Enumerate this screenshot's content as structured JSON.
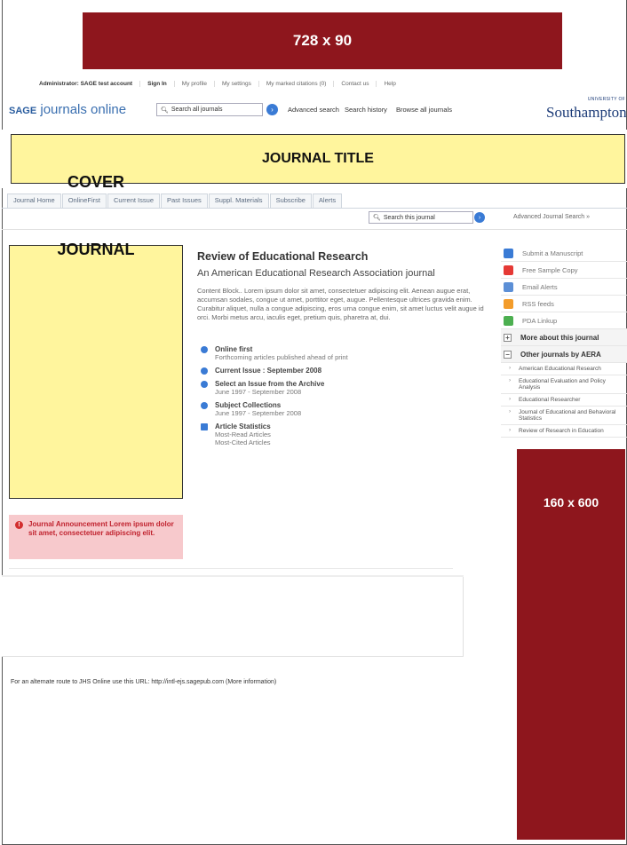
{
  "ads": {
    "top_label": "728 x 90",
    "side_label": "160 x 600",
    "color": "#8e161d"
  },
  "utility_links": [
    "Administrator: SAGE test account",
    "Sign In",
    "My profile",
    "My settings",
    "My marked citations (0)",
    "Contact us",
    "Help"
  ],
  "header": {
    "logo_sage": "SAGE",
    "logo_rest": "journals online",
    "search_placeholder": "Search all journals",
    "advanced_search": "Advanced search",
    "search_history": "Search history",
    "browse_all": "Browse all journals",
    "university_small": "UNIVERSITY OF",
    "university_name": "Southampton"
  },
  "journal_title_placeholder": "JOURNAL TITLE",
  "tabs": [
    "Journal Home",
    "OnlineFirst",
    "Current Issue",
    "Past Issues",
    "Suppl. Materials",
    "Subscribe",
    "Alerts"
  ],
  "journal_search": {
    "placeholder": "Search this journal",
    "advanced": "Advanced Journal Search »"
  },
  "cover": {
    "line1": "JOURNAL",
    "line2": "COVER"
  },
  "announcement": "Journal Announcement Lorem ipsum dolor sit amet, consectetuer adipiscing elit.",
  "main": {
    "title": "Review of Educational Research",
    "subtitle": "An American Educational Research Association journal",
    "description": "Content Block.. Lorem ipsum dolor sit amet, consectetuer adipiscing elit. Aenean augue erat, accumsan sodales, congue ut amet, porttitor eget, augue. Pellentesque ultrices gravida enim. Curabitur aliquet, nulla a congue adipiscing, eros urna congue enim, sit amet luctus velit augue id orci. Morbi metus arcu, iaculis eget, pretium quis, pharetra at, dui.",
    "items": [
      {
        "title": "Online first",
        "sub": "Forthcoming articles published ahead of print"
      },
      {
        "title": "Current Issue : September 2008",
        "sub": ""
      },
      {
        "title": "Select an Issue from the Archive",
        "sub": "June 1997 - September 2008"
      },
      {
        "title": "Subject Collections",
        "sub": "June 1997 - September 2008"
      },
      {
        "title": "Article Statistics",
        "sub": "Most-Read Articles",
        "sub2": "Most-Cited Articles"
      }
    ]
  },
  "sidebar": {
    "links": [
      "Submit a Manuscript",
      "Free Sample Copy",
      "Email Alerts",
      "RSS feeds",
      "PDA Linkup"
    ],
    "more_about": "More about this journal",
    "other_journals": "Other journals by AERA",
    "journals": [
      "American Educational Research",
      "Educational Evaluation and Policy Analysis",
      "Educational Researcher",
      "Journal of Educational and Behavioral Statistics",
      "Review of Research in Education"
    ]
  },
  "footer_note": "For an alternate route to JHS Online use this URL: http://intl-ejs.sagepub.com (More information)"
}
